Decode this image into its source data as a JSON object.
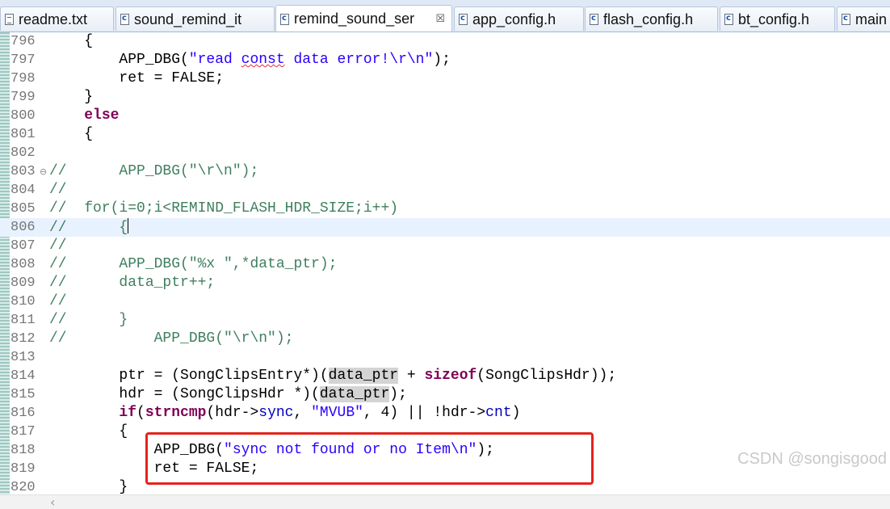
{
  "tabs": [
    {
      "label": "readme.txt",
      "icon": "text-file-icon"
    },
    {
      "label": "sound_remind_it",
      "icon": "c-file-icon"
    },
    {
      "label": "remind_sound_ser",
      "icon": "c-file-icon",
      "active": true,
      "close": "☒"
    },
    {
      "label": "app_config.h",
      "icon": "c-file-icon"
    },
    {
      "label": "flash_config.h",
      "icon": "c-file-icon"
    },
    {
      "label": "bt_config.h",
      "icon": "c-file-icon"
    },
    {
      "label": "main",
      "icon": "c-file-icon"
    }
  ],
  "editor": {
    "current_line": "806",
    "lines": [
      {
        "num": "796",
        "t": [
          "    {"
        ]
      },
      {
        "num": "797",
        "t": [
          "        APP_DBG(",
          {
            "s": "\"read ",
            "c": "str"
          },
          {
            "s": "const",
            "c": "str squig"
          },
          {
            "s": " data error!\\r\\n\"",
            "c": "str"
          },
          ");"
        ]
      },
      {
        "num": "798",
        "t": [
          "        ret = FALSE;"
        ]
      },
      {
        "num": "799",
        "t": [
          "    }"
        ]
      },
      {
        "num": "800",
        "t": [
          "    ",
          {
            "s": "else",
            "c": "kw"
          }
        ]
      },
      {
        "num": "801",
        "t": [
          "    {"
        ]
      },
      {
        "num": "802",
        "t": [
          ""
        ]
      },
      {
        "num": "803",
        "fold": "⊖",
        "t": [
          {
            "s": "//      APP_DBG(\"\\r\\n\");",
            "c": "cm"
          }
        ]
      },
      {
        "num": "804",
        "t": [
          {
            "s": "//",
            "c": "cm"
          }
        ]
      },
      {
        "num": "805",
        "t": [
          {
            "s": "//  for(i=0;i<REMIND_FLASH_HDR_SIZE;i++)",
            "c": "cm"
          }
        ]
      },
      {
        "num": "806",
        "t": [
          {
            "s": "//      {",
            "c": "cm"
          },
          {
            "caret": true
          }
        ]
      },
      {
        "num": "807",
        "t": [
          {
            "s": "//",
            "c": "cm"
          }
        ]
      },
      {
        "num": "808",
        "t": [
          {
            "s": "//      APP_DBG(\"%x \",*data_ptr);",
            "c": "cm"
          }
        ]
      },
      {
        "num": "809",
        "t": [
          {
            "s": "//      data_ptr++;",
            "c": "cm"
          }
        ]
      },
      {
        "num": "810",
        "t": [
          {
            "s": "//",
            "c": "cm"
          }
        ]
      },
      {
        "num": "811",
        "t": [
          {
            "s": "//      }",
            "c": "cm"
          }
        ]
      },
      {
        "num": "812",
        "t": [
          {
            "s": "//          APP_DBG(\"\\r\\n\");",
            "c": "cm"
          }
        ]
      },
      {
        "num": "813",
        "t": [
          ""
        ]
      },
      {
        "num": "814",
        "t": [
          "        ptr = (SongClipsEntry*)(",
          {
            "s": "data_ptr",
            "c": "occ"
          },
          " + ",
          {
            "s": "sizeof",
            "c": "kw"
          },
          "(SongClipsHdr));"
        ]
      },
      {
        "num": "815",
        "t": [
          "        hdr = (SongClipsHdr *)(",
          {
            "s": "data_ptr",
            "c": "occ"
          },
          ");"
        ]
      },
      {
        "num": "816",
        "t": [
          "        ",
          {
            "s": "if",
            "c": "kw"
          },
          "(",
          {
            "s": "strncmp",
            "c": "kw"
          },
          "(hdr->",
          {
            "s": "sync",
            "c": "fld"
          },
          ", ",
          {
            "s": "\"MVUB\"",
            "c": "str"
          },
          ", 4) || !hdr->",
          {
            "s": "cnt",
            "c": "fld"
          },
          ")"
        ]
      },
      {
        "num": "817",
        "t": [
          "        {"
        ]
      },
      {
        "num": "818",
        "t": [
          "            APP_DBG(",
          {
            "s": "\"sync not found or no Item\\n\"",
            "c": "str"
          },
          ");"
        ]
      },
      {
        "num": "819",
        "t": [
          "            ret = FALSE;"
        ]
      },
      {
        "num": "820",
        "t": [
          "        }"
        ]
      }
    ]
  },
  "scroll": {
    "left_arrow": "‹"
  },
  "watermark": "CSDN @songisgood",
  "colors": {
    "comment": "#3f7f5f",
    "string": "#2a00ff",
    "keyword": "#7f0055",
    "field": "#0000c0",
    "highlight_box": "#e5231c"
  }
}
